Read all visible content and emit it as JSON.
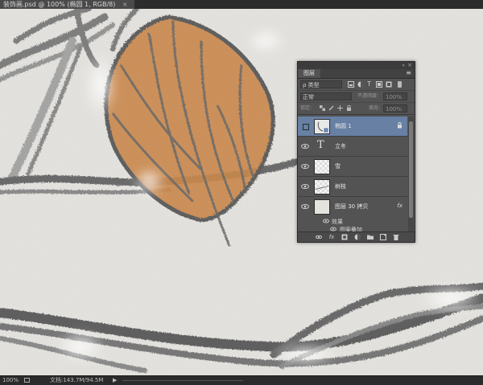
{
  "document": {
    "tab_title": "装饰画.psd @ 100% (椭圆 1, RGB/8)",
    "close_glyph": "×"
  },
  "status": {
    "zoom": "100%",
    "doc_info": "文档:143.7M/94.5M",
    "arrow": "▶"
  },
  "layers_panel": {
    "tab": "图层",
    "collapse_glyph": "«",
    "close_glyph": "×",
    "menu_glyph": "≡",
    "filter_kind": "ρ 类型",
    "blend_mode": "正常",
    "opacity_label": "不透明度:",
    "opacity_value": "100%",
    "lock_label": "锁定:",
    "fill_label": "填充:",
    "fill_value": "100%",
    "layers": [
      {
        "name": "椭圆 1",
        "selected": true,
        "locked": true
      },
      {
        "name": "立冬",
        "type": "text"
      },
      {
        "name": "雪"
      },
      {
        "name": "树枝"
      },
      {
        "name": "图层 30 拷贝",
        "fx": "fx"
      }
    ],
    "effects_label": "效果",
    "effect_item": "图案叠加",
    "lock_glyph": "🔒",
    "text_layer_glyph": "T",
    "eye_glyph": "👁"
  },
  "colors": {
    "selection": "#6780a4",
    "leaf": "#c9884e",
    "canvas": "#e9e8e4"
  },
  "icons": [
    "eye-icon",
    "lock-icon",
    "text-layer-icon",
    "fx-icon",
    "link-icon",
    "add-style-icon",
    "mask-icon",
    "adjustment-icon",
    "folder-icon",
    "new-layer-icon",
    "trash-icon"
  ]
}
